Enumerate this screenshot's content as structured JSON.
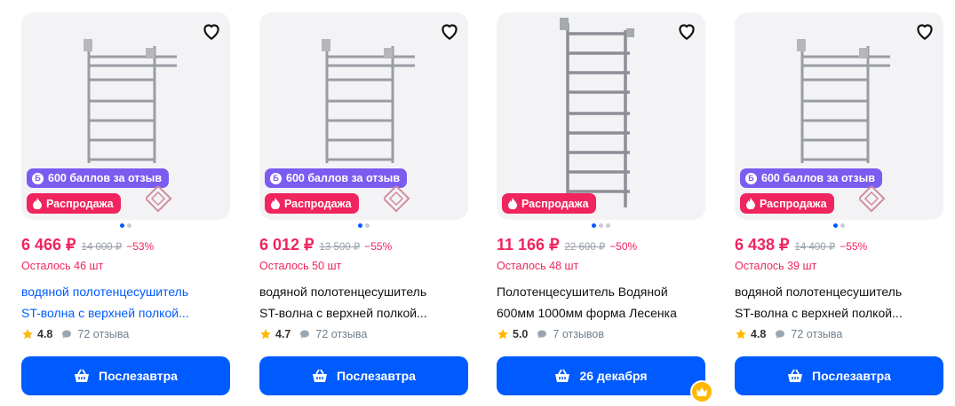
{
  "cards": [
    {
      "points_badge": "600 баллов за отзыв",
      "points_icon_letter": "Б",
      "sale_badge": "Распродажа",
      "price": "6 466 ₽",
      "old_price": "14 000 ₽",
      "discount": "−53%",
      "stock": "Осталось 46 шт",
      "title_line1": "водяной полотенцесушитель",
      "title_line2": "ST-волна с верхней полкой...",
      "rating": "4.8",
      "reviews": "72 отзыва",
      "button": "Послезавтра",
      "title_color": "#005bff",
      "has_points": true
    },
    {
      "points_badge": "600 баллов за отзыв",
      "points_icon_letter": "Б",
      "sale_badge": "Распродажа",
      "price": "6 012 ₽",
      "old_price": "13 500 ₽",
      "discount": "−55%",
      "stock": "Осталось 50 шт",
      "title_line1": "водяной полотенцесушитель",
      "title_line2": "ST-волна с верхней полкой...",
      "rating": "4.7",
      "reviews": "72 отзыва",
      "button": "Послезавтра",
      "title_color": "#111111",
      "has_points": true
    },
    {
      "sale_badge": "Распродажа",
      "price": "11 166 ₽",
      "old_price": "22 600 ₽",
      "discount": "−50%",
      "stock": "Осталось 48 шт",
      "title_line1": "Полотенцесушитель Водяной",
      "title_line2": "600мм 1000мм форма Лесенка",
      "rating": "5.0",
      "reviews": "7 отзывов",
      "button": "26 декабря",
      "title_color": "#111111",
      "has_points": false
    },
    {
      "points_badge": "600 баллов за отзыв",
      "points_icon_letter": "Б",
      "sale_badge": "Распродажа",
      "price": "6 438 ₽",
      "old_price": "14 400 ₽",
      "discount": "−55%",
      "stock": "Осталось 39 шт",
      "title_line1": "водяной полотенцесушитель",
      "title_line2": "ST-волна с верхней полкой...",
      "rating": "4.8",
      "reviews": "72 отзыва",
      "button": "Послезавтра",
      "title_color": "#111111",
      "has_points": true
    }
  ],
  "colors": {
    "accent": "#005bff",
    "sale": "#f0245e",
    "points": "#7b5cf0",
    "star": "#ffb800"
  },
  "icons": [
    "heart-icon",
    "fire-icon",
    "star-icon",
    "comment-icon",
    "basket-icon",
    "crown-icon"
  ]
}
